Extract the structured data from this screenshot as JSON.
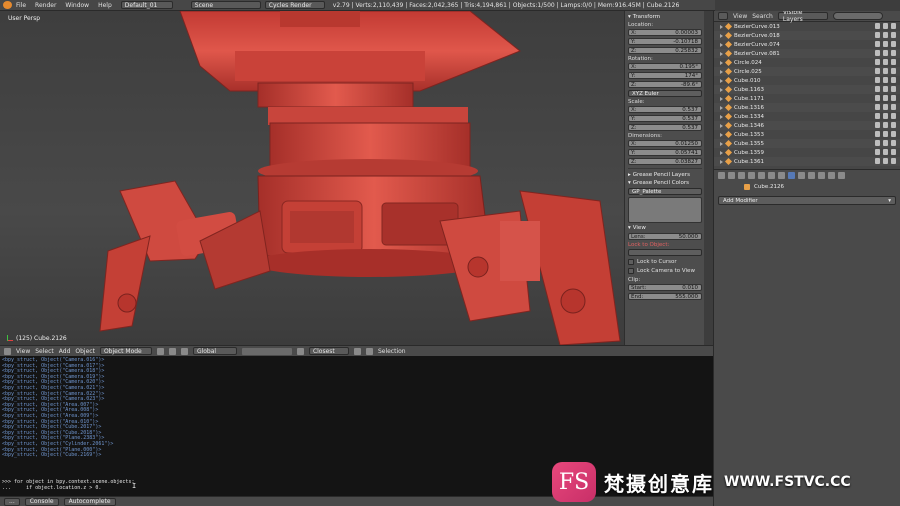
{
  "header": {
    "menus": [
      "File",
      "Render",
      "Window",
      "Help"
    ],
    "screen_layout": "Default_01",
    "scene": "Scene",
    "render_engine": "Cycles Render",
    "stats": "v2.79 | Verts:2,110,439 | Faces:2,042,365 | Tris:4,194,861 | Objects:1/500 | Lamps:0/0 | Mem:916.45M | Cube.2126"
  },
  "viewport": {
    "view_name": "User Persp",
    "active_object": "(125) Cube.2126"
  },
  "viewport_header": {
    "menus": [
      "View",
      "Select",
      "Add",
      "Object"
    ],
    "mode": "Object Mode",
    "pivot": "Global",
    "snap": "Closest",
    "selection_label": "Selection"
  },
  "npanel": {
    "transform_title": "Transform",
    "location_label": "Location:",
    "location": [
      {
        "axis": "X:",
        "value": "0.00003"
      },
      {
        "axis": "Y:",
        "value": "-0.10718"
      },
      {
        "axis": "Z:",
        "value": "0.25832"
      }
    ],
    "rotation_label": "Rotation:",
    "rotation": [
      {
        "axis": "X:",
        "value": "0.195°"
      },
      {
        "axis": "Y:",
        "value": "174°"
      },
      {
        "axis": "Z:",
        "value": "-89.6°"
      }
    ],
    "rotation_mode": "XYZ Euler",
    "scale_label": "Scale:",
    "scale": [
      {
        "axis": "X:",
        "value": "0.537"
      },
      {
        "axis": "Y:",
        "value": "0.537"
      },
      {
        "axis": "Z:",
        "value": "0.537"
      }
    ],
    "dimensions_label": "Dimensions:",
    "dimensions": [
      {
        "axis": "X:",
        "value": "0.01250"
      },
      {
        "axis": "Y:",
        "value": "0.05741"
      },
      {
        "axis": "Z:",
        "value": "0.03827"
      }
    ],
    "gp_layers": "Grease Pencil Layers",
    "gp_colors": "Grease Pencil Colors",
    "gp_palette": "GP_Palette",
    "view_title": "View",
    "lens_label": "Lens:",
    "lens_value": "50.000",
    "lock_object_label": "Lock to Object:",
    "lock_cursor": "Lock to Cursor",
    "lock_camera": "Lock Camera to View",
    "clip_label": "Clip:",
    "clip_start_label": "Start:",
    "clip_start": "0.010",
    "clip_end_label": "End:",
    "clip_end": "555.000"
  },
  "console": {
    "output": [
      "<bpy_struct, Object(\"Camera.016\")>",
      "<bpy_struct, Object(\"Camera.017\")>",
      "<bpy_struct, Object(\"Camera.018\")>",
      "<bpy_struct, Object(\"Camera.019\")>",
      "<bpy_struct, Object(\"Camera.020\")>",
      "<bpy_struct, Object(\"Camera.021\")>",
      "<bpy_struct, Object(\"Camera.022\")>",
      "<bpy_struct, Object(\"Camera.023\")>",
      "<bpy_struct, Object(\"Area.007\")>",
      "<bpy_struct, Object(\"Area.008\")>",
      "<bpy_struct, Object(\"Area.009\")>",
      "<bpy_struct, Object(\"Area.010\")>",
      "<bpy_struct, Object(\"Cube.2017\")>",
      "<bpy_struct, Object(\"Cube.2018\")>",
      "<bpy_struct, Object(\"Plane.2383\")>",
      "<bpy_struct, Object(\"Cylinder.2061\")>",
      "<bpy_struct, Object(\"Plane.000\")>",
      "<bpy_struct, Object(\"Cube.2169\")>"
    ],
    "input_line1": ">>> for object in bpy.context.scene.objects:",
    "input_line2": "...     if object.location.z > 0.",
    "footer_more": "...",
    "footer_console": "Console",
    "footer_autocomplete": "Autocomplete"
  },
  "outliner": {
    "view_label": "View",
    "search_label": "Search",
    "display_mode": "Visible Layers",
    "items": [
      "BezierCurve.013",
      "BezierCurve.018",
      "BezierCurve.074",
      "BezierCurve.081",
      "Circle.024",
      "Circle.025",
      "Cube.010",
      "Cube.1163",
      "Cube.1171",
      "Cube.1316",
      "Cube.1334",
      "Cube.1346",
      "Cube.1353",
      "Cube.1355",
      "Cube.1359",
      "Cube.1361"
    ]
  },
  "properties": {
    "breadcrumb": "Cube.2126",
    "add_modifier": "Add Modifier"
  },
  "watermark": {
    "logo_text": "FS",
    "cn_text": "梵摄创意库",
    "url_text": "WWW.FSTVC.CC"
  },
  "colors": {
    "model_red": "#d2453c",
    "console_output": "#6f95ce",
    "accent_blue": "#5679b6",
    "object_orange": "#e8a048"
  }
}
